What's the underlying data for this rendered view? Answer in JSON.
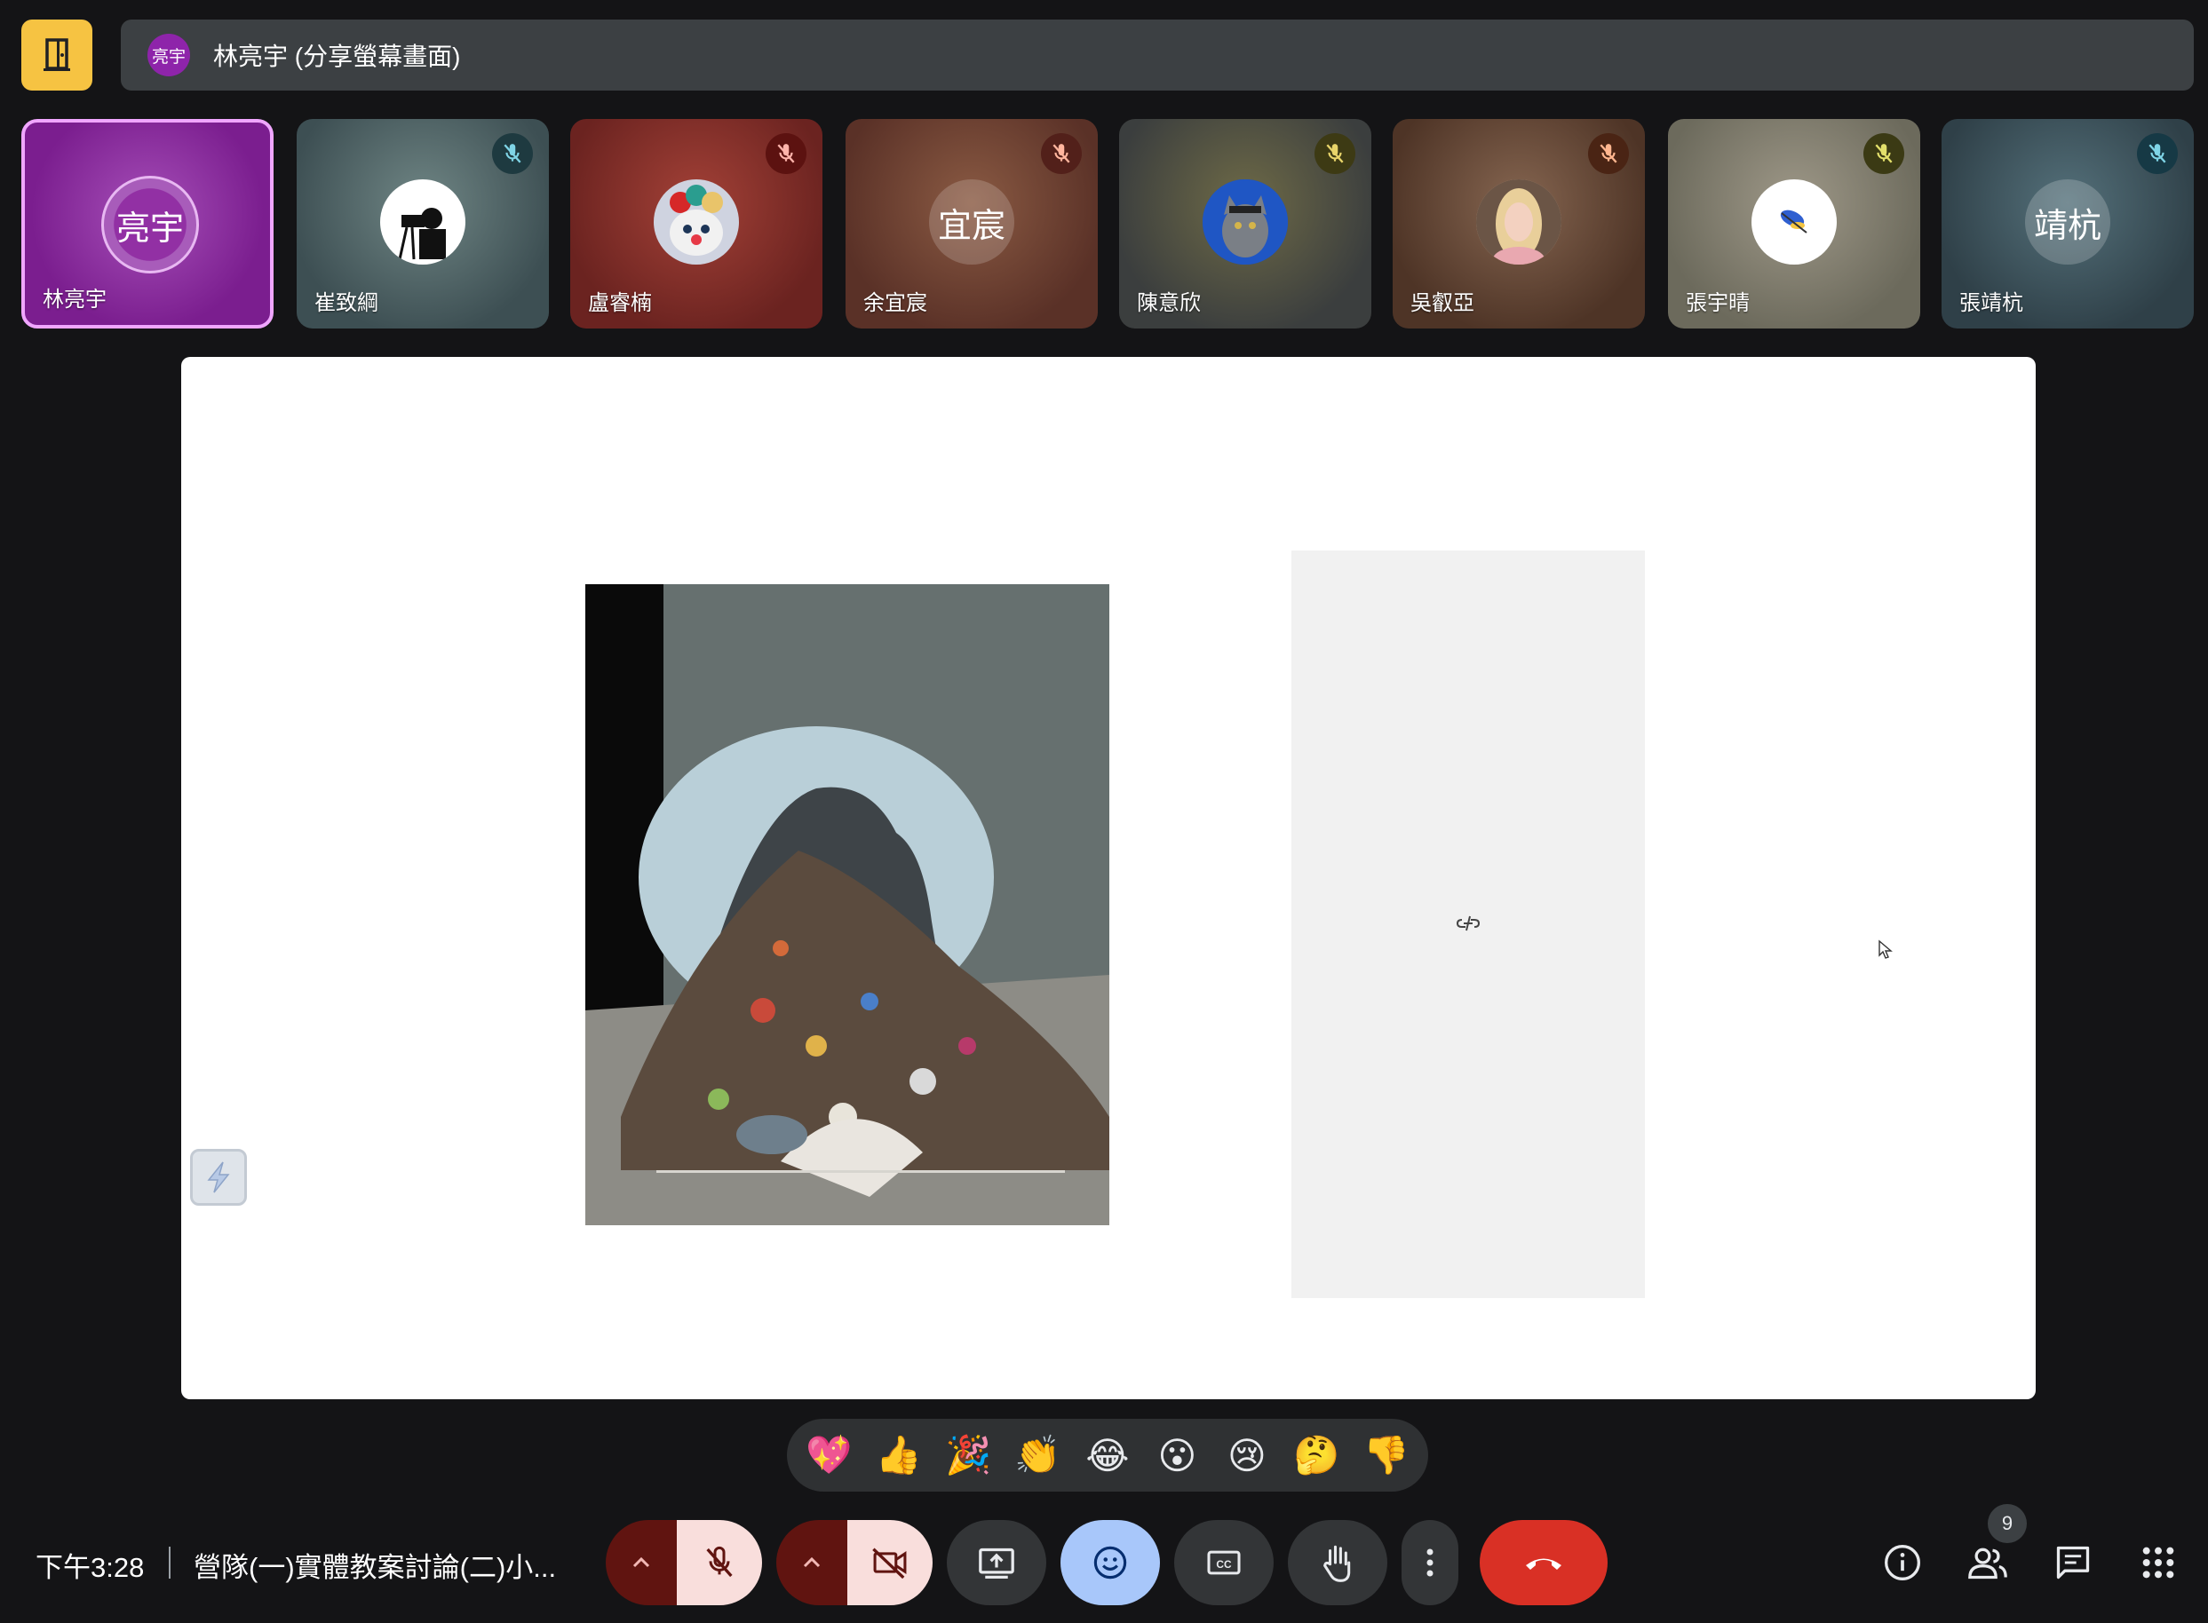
{
  "header": {
    "presenter_avatar": "亮宇",
    "title": "林亮宇 (分享螢幕畫面)",
    "door_icon": "door-exit-icon"
  },
  "participants": [
    {
      "name": "林亮宇",
      "initials": "亮宇",
      "active": true
    },
    {
      "name": "崔致綱",
      "muted": true
    },
    {
      "name": "盧睿楠",
      "muted": true
    },
    {
      "name": "余宜宸",
      "initials": "宜宸",
      "muted": true
    },
    {
      "name": "陳意欣",
      "muted": true
    },
    {
      "name": "吳叡亞",
      "muted": true
    },
    {
      "name": "張宇晴",
      "muted": true
    },
    {
      "name": "張靖杭",
      "initials": "靖杭",
      "muted": true
    }
  ],
  "reactions": [
    "💖",
    "👍",
    "🎉",
    "👏",
    "😂",
    "😮",
    "😢",
    "🤔",
    "👎"
  ],
  "footer": {
    "time": "下午3:28",
    "meeting_name": "營隊(一)實體教案討論(二)小...",
    "participant_count": "9"
  },
  "colors": {
    "accent_yellow": "#f6c342",
    "end_call_red": "#d93025",
    "active_tile": "#9c27b0",
    "reaction_active": "#a8c7fa"
  }
}
